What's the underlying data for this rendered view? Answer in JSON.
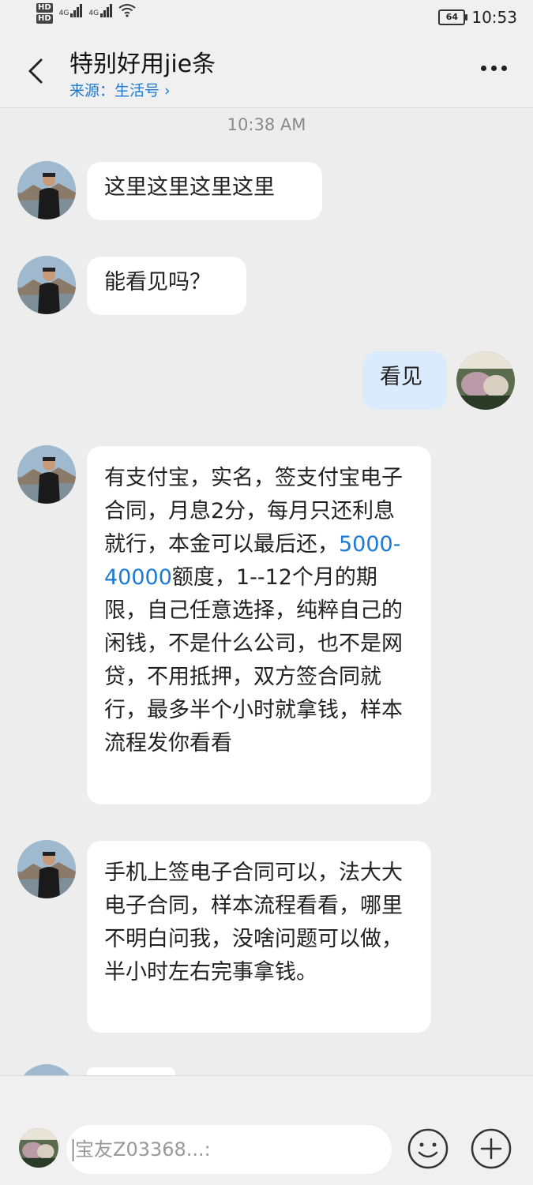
{
  "status_bar": {
    "hd1": "HD",
    "hd2": "HD",
    "net1": "4G",
    "net2": "4G",
    "battery": "64",
    "time": "10:53"
  },
  "header": {
    "title": "特别好用jie条",
    "source": "来源：生活号 ›"
  },
  "chat": {
    "timestamp": "10:38 AM",
    "messages": [
      {
        "from": "other",
        "text": "这里这里这里这里"
      },
      {
        "from": "other",
        "text": "能看见吗？"
      },
      {
        "from": "me",
        "text": "看见"
      },
      {
        "from": "other",
        "text_before": "有支付宝，实名，签支付宝电子合同，月息2分，每月只还利息就行，本金可以最后还，",
        "link_text": "5000-40000",
        "text_after": "额度，1--12个月的期限，自己任意选择，纯粹自己的闲钱，不是什么公司，也不是网贷，不用抵押，双方签合同就行，最多半个小时就拿钱，样本流程发你看看"
      },
      {
        "from": "other",
        "text": "手机上签电子合同可以，法大大电子合同，样本流程看看，哪里不明白问我，没啥问题可以做，半小时左右完事拿钱。"
      }
    ]
  },
  "input": {
    "placeholder": "宝友Z03368...:"
  },
  "colors": {
    "accent": "#1a7ad6",
    "my_bubble": "#d9ebfc",
    "background": "#ededed"
  }
}
